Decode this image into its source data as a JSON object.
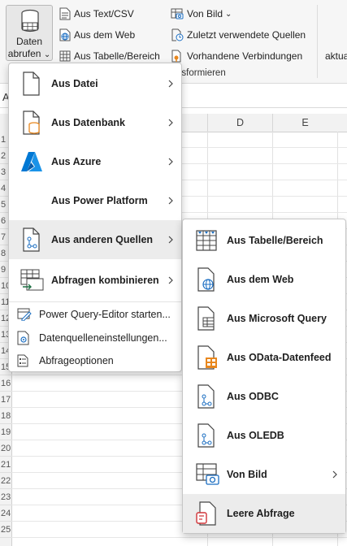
{
  "ribbon": {
    "get_data_button": {
      "line1": "Daten",
      "line2": "abrufen",
      "caret": "⌄"
    },
    "col1": [
      {
        "label": "Aus Text/CSV",
        "icon": "text-csv-icon"
      },
      {
        "label": "Aus dem Web",
        "icon": "web-icon"
      },
      {
        "label": "Aus Tabelle/Bereich",
        "icon": "table-range-icon"
      }
    ],
    "col2": [
      {
        "label": "Von Bild",
        "caret": "⌄",
        "icon": "image-icon"
      },
      {
        "label": "Zuletzt verwendete Quellen",
        "icon": "recent-sources-icon"
      },
      {
        "label": "Vorhandene Verbindungen",
        "icon": "existing-connections-icon"
      }
    ],
    "group_label_partial": "nsformieren",
    "right_partial": "aktua"
  },
  "sheet": {
    "name_box_partial": "A",
    "columns": [
      "D",
      "E"
    ],
    "rows": [
      "1",
      "2",
      "3",
      "4",
      "5",
      "6",
      "7",
      "8",
      "9",
      "10",
      "11",
      "12",
      "13",
      "14",
      "15",
      "16",
      "17",
      "18",
      "19",
      "20",
      "21",
      "22",
      "23",
      "24",
      "25"
    ]
  },
  "menu": {
    "items": [
      {
        "label": "Aus Datei",
        "icon": "file-icon",
        "has_submenu": true
      },
      {
        "label": "Aus Datenbank",
        "icon": "database-icon",
        "has_submenu": true
      },
      {
        "label": "Aus Azure",
        "icon": "azure-icon",
        "has_submenu": true
      },
      {
        "label": "Aus Power Platform",
        "icon": "",
        "has_submenu": true
      },
      {
        "label": "Aus anderen Quellen",
        "icon": "other-sources-icon",
        "has_submenu": true,
        "highlighted": true
      },
      {
        "label": "Abfragen kombinieren",
        "icon": "combine-queries-icon",
        "has_submenu": true
      }
    ],
    "small_items": [
      {
        "label": "Power Query-Editor starten...",
        "icon": "power-query-editor-icon"
      },
      {
        "label": "Datenquelleneinstellungen...",
        "icon": "data-source-settings-icon"
      },
      {
        "label": "Abfrageoptionen",
        "icon": "query-options-icon"
      }
    ]
  },
  "submenu": {
    "items": [
      {
        "label": "Aus Tabelle/Bereich",
        "icon": "table-range-icon"
      },
      {
        "label": "Aus dem Web",
        "icon": "web-icon"
      },
      {
        "label": "Aus Microsoft Query",
        "icon": "microsoft-query-icon"
      },
      {
        "label": "Aus OData-Datenfeed",
        "icon": "odata-feed-icon"
      },
      {
        "label": "Aus ODBC",
        "icon": "odbc-icon"
      },
      {
        "label": "Aus OLEDB",
        "icon": "oledb-icon"
      },
      {
        "label": "Von Bild",
        "icon": "image-icon",
        "has_submenu": true
      },
      {
        "label": "Leere Abfrage",
        "icon": "blank-query-icon",
        "highlighted": true
      }
    ]
  },
  "colors": {
    "accent_blue": "#1b6ec2",
    "azure_blue": "#0078d4",
    "orange": "#e8871e",
    "green": "#1e7145",
    "highlight": "#ececec"
  }
}
